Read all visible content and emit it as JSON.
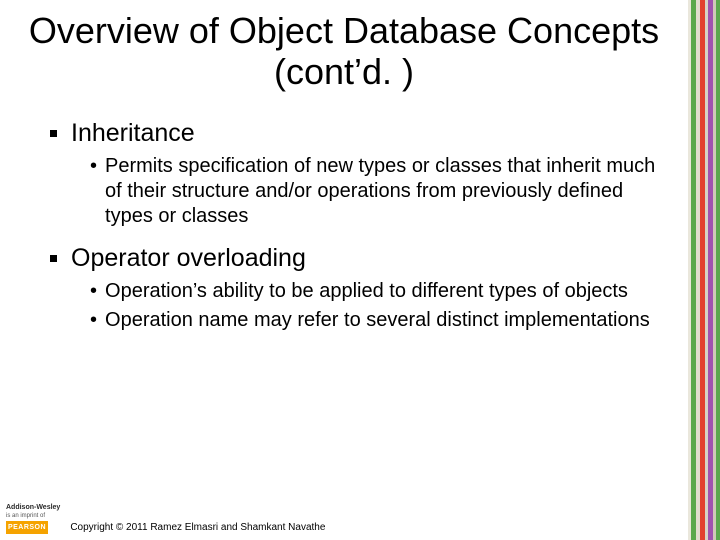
{
  "title": "Overview of Object Database Concepts (cont’d. )",
  "bullets": {
    "b1": {
      "label": "Inheritance"
    },
    "b1s1": "Permits specification of new types or classes that inherit much of their structure and/or operations from previously defined types or classes",
    "b2": {
      "label": "Operator overloading"
    },
    "b2s1": "Operation’s ability to be applied to different types of objects",
    "b2s2": "Operation name may refer to several distinct implementations"
  },
  "footer": {
    "pub_name": "Addison-Wesley",
    "pub_sub": "is an imprint of",
    "brand": "PEARSON",
    "copyright": "Copyright © 2011 Ramez Elmasri and Shamkant Navathe"
  }
}
